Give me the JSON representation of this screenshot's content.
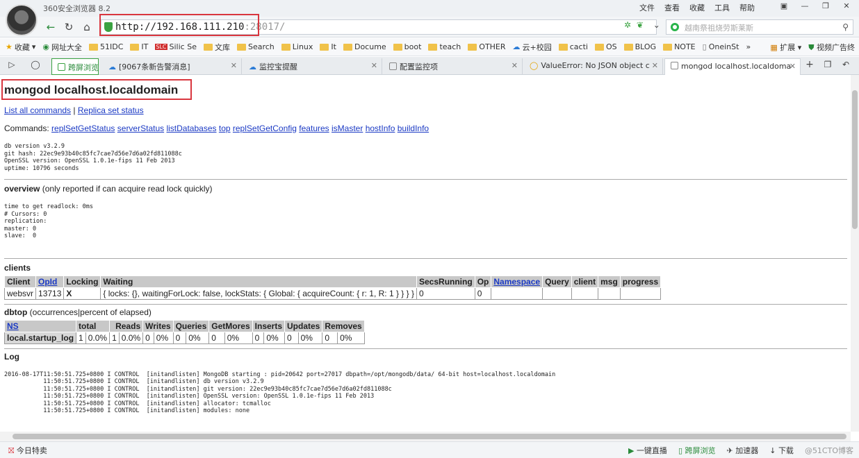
{
  "browser": {
    "app_title": "360安全浏览器 8.2",
    "menu": [
      "文件",
      "查看",
      "收藏",
      "工具",
      "帮助"
    ],
    "url_host": "http://192.168.111.210",
    "url_rest": ":28017/",
    "search_placeholder": "越南祭祖烧劳斯莱斯",
    "bookmarks": [
      "收藏",
      "网址大全",
      "51IDC",
      "IT",
      "Silic Se",
      "文库",
      "Search",
      "Linux",
      "It",
      "Docume",
      "boot",
      "teach",
      "OTHER",
      "云+校园",
      "cacti",
      "OS",
      "BLOG",
      "NOTE",
      "OneinSt"
    ],
    "bookmark_more": "»",
    "bookmark_right": [
      "扩展",
      "视频广告终"
    ],
    "tabs": [
      {
        "label": "跨屏浏览"
      },
      {
        "label": "[9067条新告警消息]"
      },
      {
        "label": "监控宝提醒"
      },
      {
        "label": "配置监控项"
      },
      {
        "label": "ValueError: No JSON object c"
      },
      {
        "label": "mongod localhost.localdoma"
      }
    ],
    "status_left": "今日特卖",
    "status_right": [
      "一键直播",
      "跨屏浏览",
      "加速器",
      "下载"
    ],
    "watermark": "@51CTO博客"
  },
  "page": {
    "title": "mongod localhost.localdomain",
    "link_all_commands": "List all commands",
    "link_sep": "|",
    "link_replset": "Replica set status",
    "commands_label": "Commands:",
    "commands": [
      "replSetGetStatus",
      "serverStatus",
      "listDatabases",
      "top",
      "replSetGetConfig",
      "features",
      "isMaster",
      "hostInfo",
      "buildInfo"
    ],
    "version_info": "db version v3.2.9\ngit hash: 22ec9e93b40c85fc7cae7d56e7d6a02fd811088c\nOpenSSL version: OpenSSL 1.0.1e-fips 11 Feb 2013\nuptime: 10796 seconds",
    "overview_title": "overview",
    "overview_note": "(only reported if can acquire read lock quickly)",
    "overview_info": "time to get readlock: 0ms\n# Cursors: 0\nreplication:\nmaster: 0\nslave:  0",
    "clients_title": "clients",
    "clients_headers": [
      "Client",
      "OpId",
      "Locking",
      "Waiting",
      "SecsRunning",
      "Op",
      "Namespace",
      "Query",
      "client",
      "msg",
      "progress"
    ],
    "clients_row": [
      "websvr",
      "13713",
      "X",
      "{ locks: {}, waitingForLock: false, lockStats: { Global: { acquireCount: { r: 1, R: 1 } } } }",
      "0",
      "0",
      "",
      "",
      "",
      "",
      ""
    ],
    "dbtop_title": "dbtop",
    "dbtop_note": "(occurrences|percent of elapsed)",
    "dbtop_headers": [
      "NS",
      "total",
      "",
      "Reads",
      "",
      "Writes",
      "",
      "Queries",
      "",
      "GetMores",
      "",
      "Inserts",
      "",
      "Updates",
      "",
      "Removes",
      ""
    ],
    "dbtop_header_labels": [
      "NS",
      "total",
      "Reads",
      "Writes",
      "Queries",
      "GetMores",
      "Inserts",
      "Updates",
      "Removes"
    ],
    "dbtop_row": [
      "local.startup_log",
      "1",
      "0.0%",
      "1",
      "0.0%",
      "0",
      "0%",
      "0",
      "0%",
      "0",
      "0%",
      "0",
      "0%",
      "0",
      "0%",
      "0",
      "0%"
    ],
    "log_title": "Log",
    "log_text": "2016-08-17T11:50:51.725+0800 I CONTROL  [initandlisten] MongoDB starting : pid=20642 port=27017 dbpath=/opt/mongodb/data/ 64-bit host=localhost.localdomain\n           11:50:51.725+0800 I CONTROL  [initandlisten] db version v3.2.9\n           11:50:51.725+0800 I CONTROL  [initandlisten] git version: 22ec9e93b40c85fc7cae7d56e7d6a02fd811088c\n           11:50:51.725+0800 I CONTROL  [initandlisten] OpenSSL version: OpenSSL 1.0.1e-fips 11 Feb 2013\n           11:50:51.725+0800 I CONTROL  [initandlisten] allocator: tcmalloc\n           11:50:51.725+0800 I CONTROL  [initandlisten] modules: none"
  }
}
